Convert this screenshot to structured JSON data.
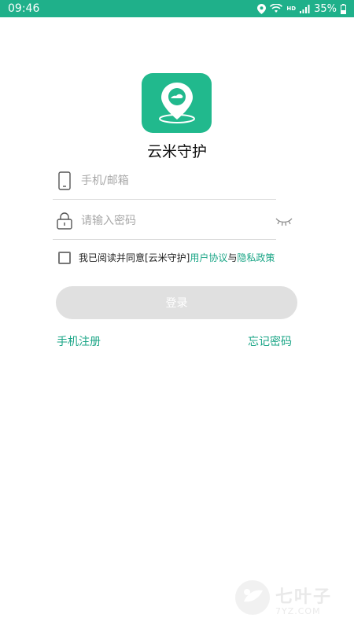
{
  "status_bar": {
    "time": "09:46",
    "network_label": "HD",
    "battery": "35%"
  },
  "app": {
    "name": "云米守护"
  },
  "form": {
    "phone_placeholder": "手机/邮箱",
    "password_placeholder": "请输入密码"
  },
  "agreement": {
    "prefix": "我已阅读并同意[云米守护] ",
    "user_agreement": "用户协议",
    "and": "与",
    "privacy_policy": "隐私政策",
    "checked": false
  },
  "login_button": "登录",
  "links": {
    "register": "手机注册",
    "forgot_password": "忘记密码"
  },
  "watermark": {
    "cn": "七叶子",
    "en": "7YZ.COM"
  },
  "colors": {
    "brand": "#1fb08a",
    "link": "#1aa586",
    "button_disabled": "#e0e0e0"
  },
  "icons": [
    "location-icon",
    "wifi-icon",
    "signal-icon",
    "battery-icon",
    "phone-icon",
    "lock-icon",
    "eye-closed-icon"
  ]
}
